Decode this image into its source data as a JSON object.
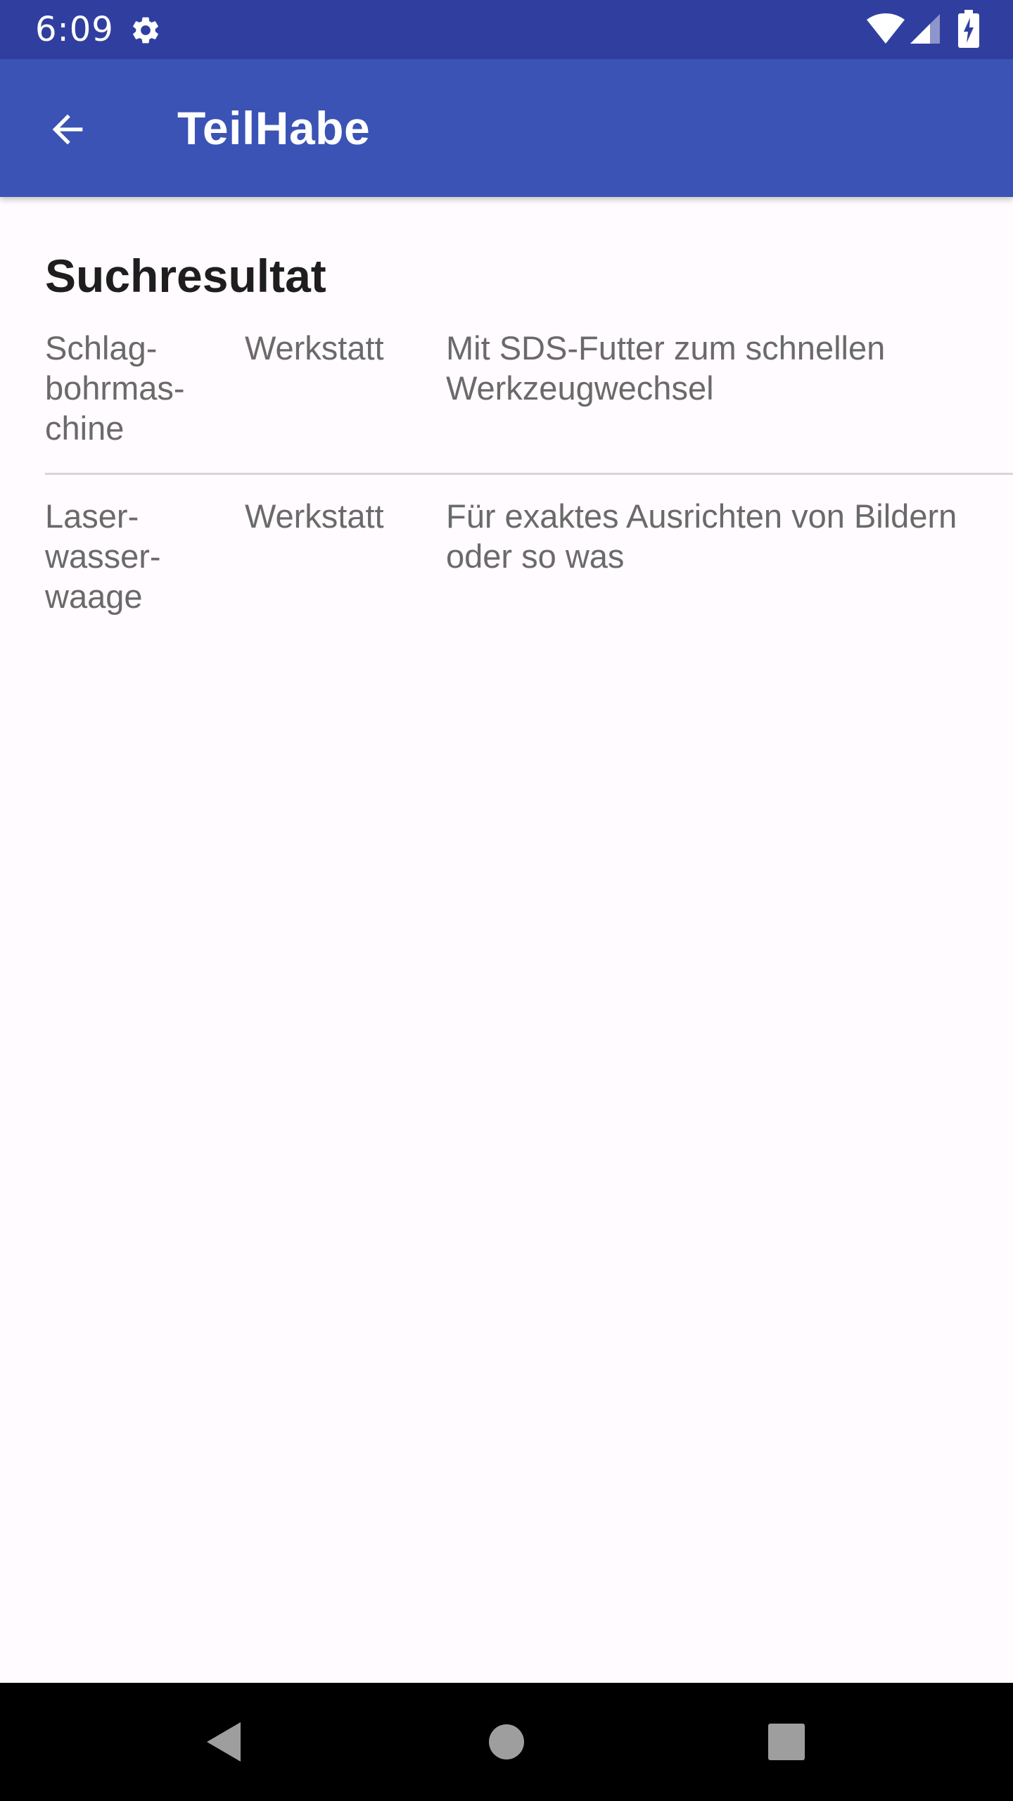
{
  "status_bar": {
    "time": "6:09",
    "icons": [
      "gear-icon",
      "wifi-icon",
      "cell-signal-icon",
      "battery-charging-icon"
    ]
  },
  "app_bar": {
    "title": "TeilHabe",
    "back_icon": "arrow-left-icon"
  },
  "main": {
    "section_title": "Suchresultat",
    "results": [
      {
        "name": "Schlag-\nbohrmas-\nchine",
        "category": "Werkstatt",
        "description": "Mit SDS-Futter zum schnellen Werkzeugwechsel"
      },
      {
        "name": "Laser-\nwasser-\nwaage",
        "category": "Werkstatt",
        "description": "Für exaktes Ausrichten von Bildern oder so was"
      }
    ]
  },
  "nav_bar": {
    "icons": [
      "nav-back-icon",
      "nav-home-icon",
      "nav-recents-icon"
    ]
  },
  "colors": {
    "status_bar": "#303f9f",
    "app_bar": "#3a53b5",
    "background": "#fffbfe",
    "text_primary": "#1e1e1e",
    "text_secondary": "#6a6a6a",
    "divider": "#d6d6d6"
  }
}
